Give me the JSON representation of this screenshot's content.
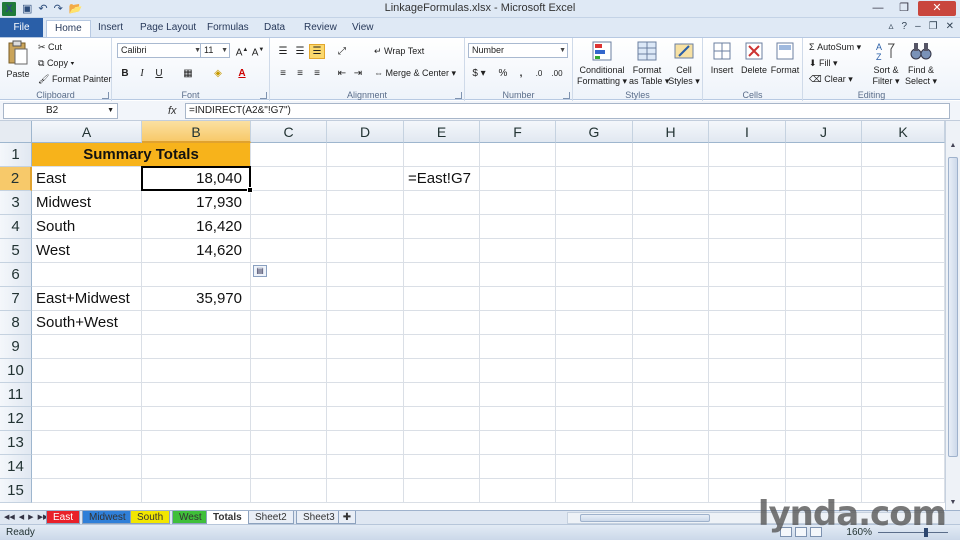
{
  "window": {
    "title": "LinkageFormulas.xlsx - Microsoft Excel",
    "qat_icons": [
      "excel-logo-icon",
      "save-icon",
      "undo-icon",
      "redo-icon",
      "open-icon"
    ]
  },
  "ribbon_tabs": {
    "file": "File",
    "items": [
      "Home",
      "Insert",
      "Page Layout",
      "Formulas",
      "Data",
      "Review",
      "View"
    ],
    "active": "Home"
  },
  "ribbon": {
    "clipboard": {
      "label": "Clipboard",
      "paste": "Paste",
      "cut": "Cut",
      "copy": "Copy ▾",
      "format_painter": "Format Painter"
    },
    "font": {
      "label": "Font",
      "name": "Calibri",
      "size": "11",
      "bold": "B",
      "italic": "I",
      "underline": "U"
    },
    "alignment": {
      "label": "Alignment",
      "wrap_text": "Wrap Text",
      "merge_center": "Merge & Center ▾"
    },
    "number": {
      "label": "Number",
      "format": "Number",
      "currency": "$ ▾",
      "percent": "%",
      "comma": ","
    },
    "styles": {
      "label": "Styles",
      "conditional": "Conditional",
      "conditional2": "Formatting ▾",
      "format_as": "Format",
      "format_as2": "as Table ▾",
      "cell": "Cell",
      "cell2": "Styles ▾"
    },
    "cells": {
      "label": "Cells",
      "insert": "Insert",
      "delete": "Delete",
      "format": "Format"
    },
    "editing": {
      "label": "Editing",
      "autosum": "AutoSum ▾",
      "fill": "Fill ▾",
      "clear": "Clear ▾",
      "sort": "Sort &",
      "sort2": "Filter ▾",
      "find": "Find &",
      "find2": "Select ▾"
    }
  },
  "formula_bar": {
    "name_box": "B2",
    "fx": "fx",
    "formula": "=INDIRECT(A2&\"!G7\")"
  },
  "columns": [
    "A",
    "B",
    "C",
    "D",
    "E",
    "F",
    "G",
    "H",
    "I",
    "J",
    "K"
  ],
  "rows": [
    "1",
    "2",
    "3",
    "4",
    "5",
    "6",
    "7",
    "8",
    "9",
    "10",
    "11",
    "12",
    "13",
    "14",
    "15"
  ],
  "cells": {
    "A1": "Summary Totals",
    "A2": "East",
    "B2": "18,040",
    "A3": "Midwest",
    "B3": "17,930",
    "A4": "South",
    "B4": "16,420",
    "A5": "West",
    "B5": "14,620",
    "A7": "East+Midwest",
    "B7": "35,970",
    "A8": "South+West",
    "E2": "=East!G7"
  },
  "selected_cell": "B2",
  "sheet_tabs": [
    {
      "name": "East",
      "color": "#e8202a"
    },
    {
      "name": "Midwest",
      "color": "#2f7fd8"
    },
    {
      "name": "South",
      "color": "#f2e600"
    },
    {
      "name": "West",
      "color": "#3fbf3a"
    },
    {
      "name": "Totals",
      "color": ""
    },
    {
      "name": "Sheet2",
      "color": ""
    },
    {
      "name": "Sheet3",
      "color": ""
    }
  ],
  "status": {
    "ready": "Ready",
    "zoom": "160%"
  },
  "watermark": "lynda.com"
}
